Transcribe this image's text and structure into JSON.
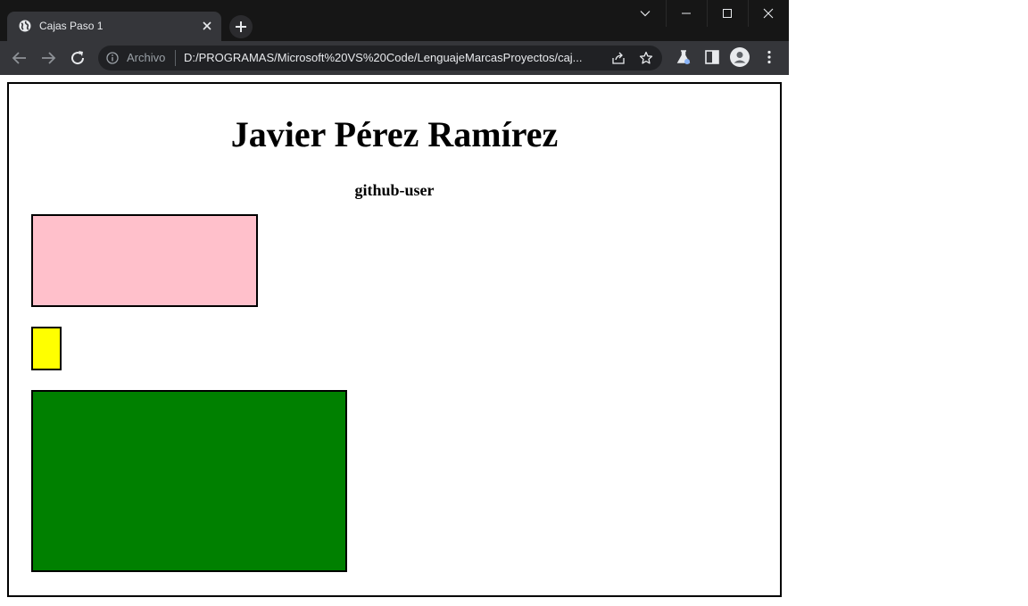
{
  "browser": {
    "tab_title": "Cajas Paso 1",
    "address": {
      "scheme_label": "Archivo",
      "url": "D:/PROGRAMAS/Microsoft%20VS%20Code/LenguajeMarcasProyectos/caj..."
    },
    "theme": {
      "tabstrip": "#161616",
      "toolbar": "#35363a",
      "omnibox": "#202124",
      "text": "#e8eaed"
    }
  },
  "page": {
    "title": "Javier Pérez Ramírez",
    "subtitle": "github-user",
    "boxes": [
      {
        "name": "pink-box",
        "color": "#ffc0cb"
      },
      {
        "name": "yellow-box",
        "color": "#ffff00"
      },
      {
        "name": "green-box",
        "color": "#008000"
      }
    ],
    "border_color": "#000000"
  }
}
